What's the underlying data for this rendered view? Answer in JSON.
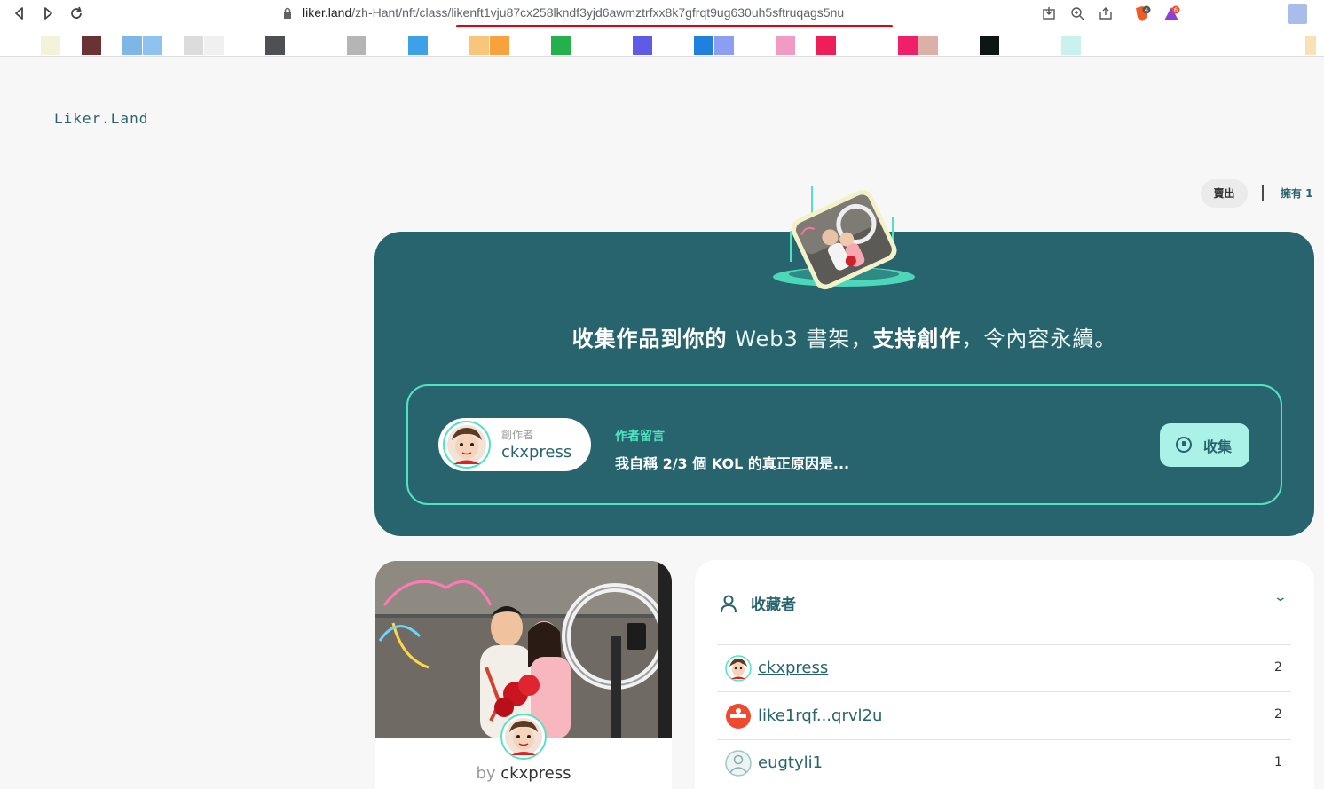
{
  "browser": {
    "url_prefix": "liker.land",
    "url_path_dim": "/zh-Hant/nft/class/",
    "url_class_id": "likenft1vju87cx258lkndf3yjd6awmztrfxx8k7gfrqt9ug630uh5sftruqags5nu",
    "brave_badge": "4",
    "rewards_badge": "6",
    "bookmark_colors": [
      "#f3f3d9",
      "#6b3234",
      "#7eb6e5",
      "#8ec3f0",
      "#dcdcdc",
      "#f0f0f0",
      "#4e5054",
      "#b5b5b5",
      "#3ea1e8",
      "#f9c57a",
      "#f9a13c",
      "#24b04a",
      "#5e5ce6",
      "#1f80dd",
      "#8c9ef2",
      "#f19ac2",
      "#ee1e58",
      "#ef1f6a",
      "#dbb0a6",
      "#0f1515",
      "#c9f2ee",
      "#f8e2b3"
    ]
  },
  "site": {
    "logo": "Liker.Land",
    "sell_label": "賣出",
    "own_label": "擁有 1",
    "slogan_part1": "收集作品到你的",
    "slogan_part2": " Web3 書架，",
    "slogan_part3": "支持創作",
    "slogan_part4": "，令內容永續。"
  },
  "creator": {
    "label": "創作者",
    "name": "ckxpress"
  },
  "message": {
    "label": "作者留言",
    "text": "我自稱 2/3 個 KOL 的真正原因是..."
  },
  "collect_button": {
    "label": "收集"
  },
  "nft_card": {
    "by": "by",
    "author": "ckxpress"
  },
  "collectors": {
    "title": "收藏者",
    "rows": [
      {
        "name": "ckxpress",
        "count": "2"
      },
      {
        "name": "like1rqf...qrvl2u",
        "count": "2"
      },
      {
        "name": "eugtyli1",
        "count": "1"
      }
    ]
  },
  "colors": {
    "brand": "#28646e",
    "accent": "#50e3c2",
    "button_bg": "#aaf1e7"
  }
}
